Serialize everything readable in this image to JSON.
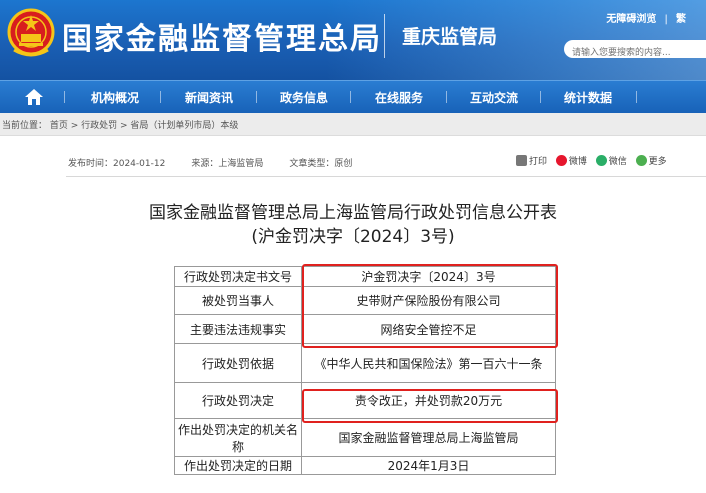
{
  "header": {
    "site_title": "国家金融监督管理总局",
    "branch": "重庆监管局",
    "top_links": [
      "无障碍浏览",
      "繁"
    ],
    "search_placeholder": "请输入您要搜索的内容..."
  },
  "nav": {
    "items": [
      "机构概况",
      "新闻资讯",
      "政务信息",
      "在线服务",
      "互动交流",
      "统计数据"
    ]
  },
  "breadcrumb": {
    "text": "当前位置： 首页 > 行政处罚 > 省局（计划单列市局）本级"
  },
  "meta": {
    "publish_time": "发布时间：2024-01-12",
    "source": "来源：上海监管局",
    "doc_type": "文章类型：原创"
  },
  "share": {
    "print": "打印",
    "weibo": "微博",
    "wechat": "微信",
    "more": "更多"
  },
  "article": {
    "title_line1": "国家金融监督管理总局上海监管局行政处罚信息公开表",
    "title_line2": "(沪金罚决字〔2024〕3号)"
  },
  "table": {
    "rows": [
      {
        "key": "行政处罚决定书文号",
        "value": "沪金罚决字〔2024〕3号"
      },
      {
        "key": "被处罚当事人",
        "value": "史带财产保险股份有限公司"
      },
      {
        "key": "主要违法违规事实",
        "value": "网络安全管控不足"
      },
      {
        "key": "行政处罚依据",
        "value": "《中华人民共和国保险法》第一百六十一条"
      },
      {
        "key": "行政处罚决定",
        "value": "责令改正，并处罚款20万元"
      },
      {
        "key": "作出处罚决定的机关名称",
        "value": "国家金融监督管理总局上海监管局"
      },
      {
        "key": "作出处罚决定的日期",
        "value": "2024年1月3日"
      }
    ]
  },
  "colors": {
    "header_blue": "#1a5fb4",
    "nav_blue": "#1862b8",
    "highlight_red": "#e0211e"
  }
}
